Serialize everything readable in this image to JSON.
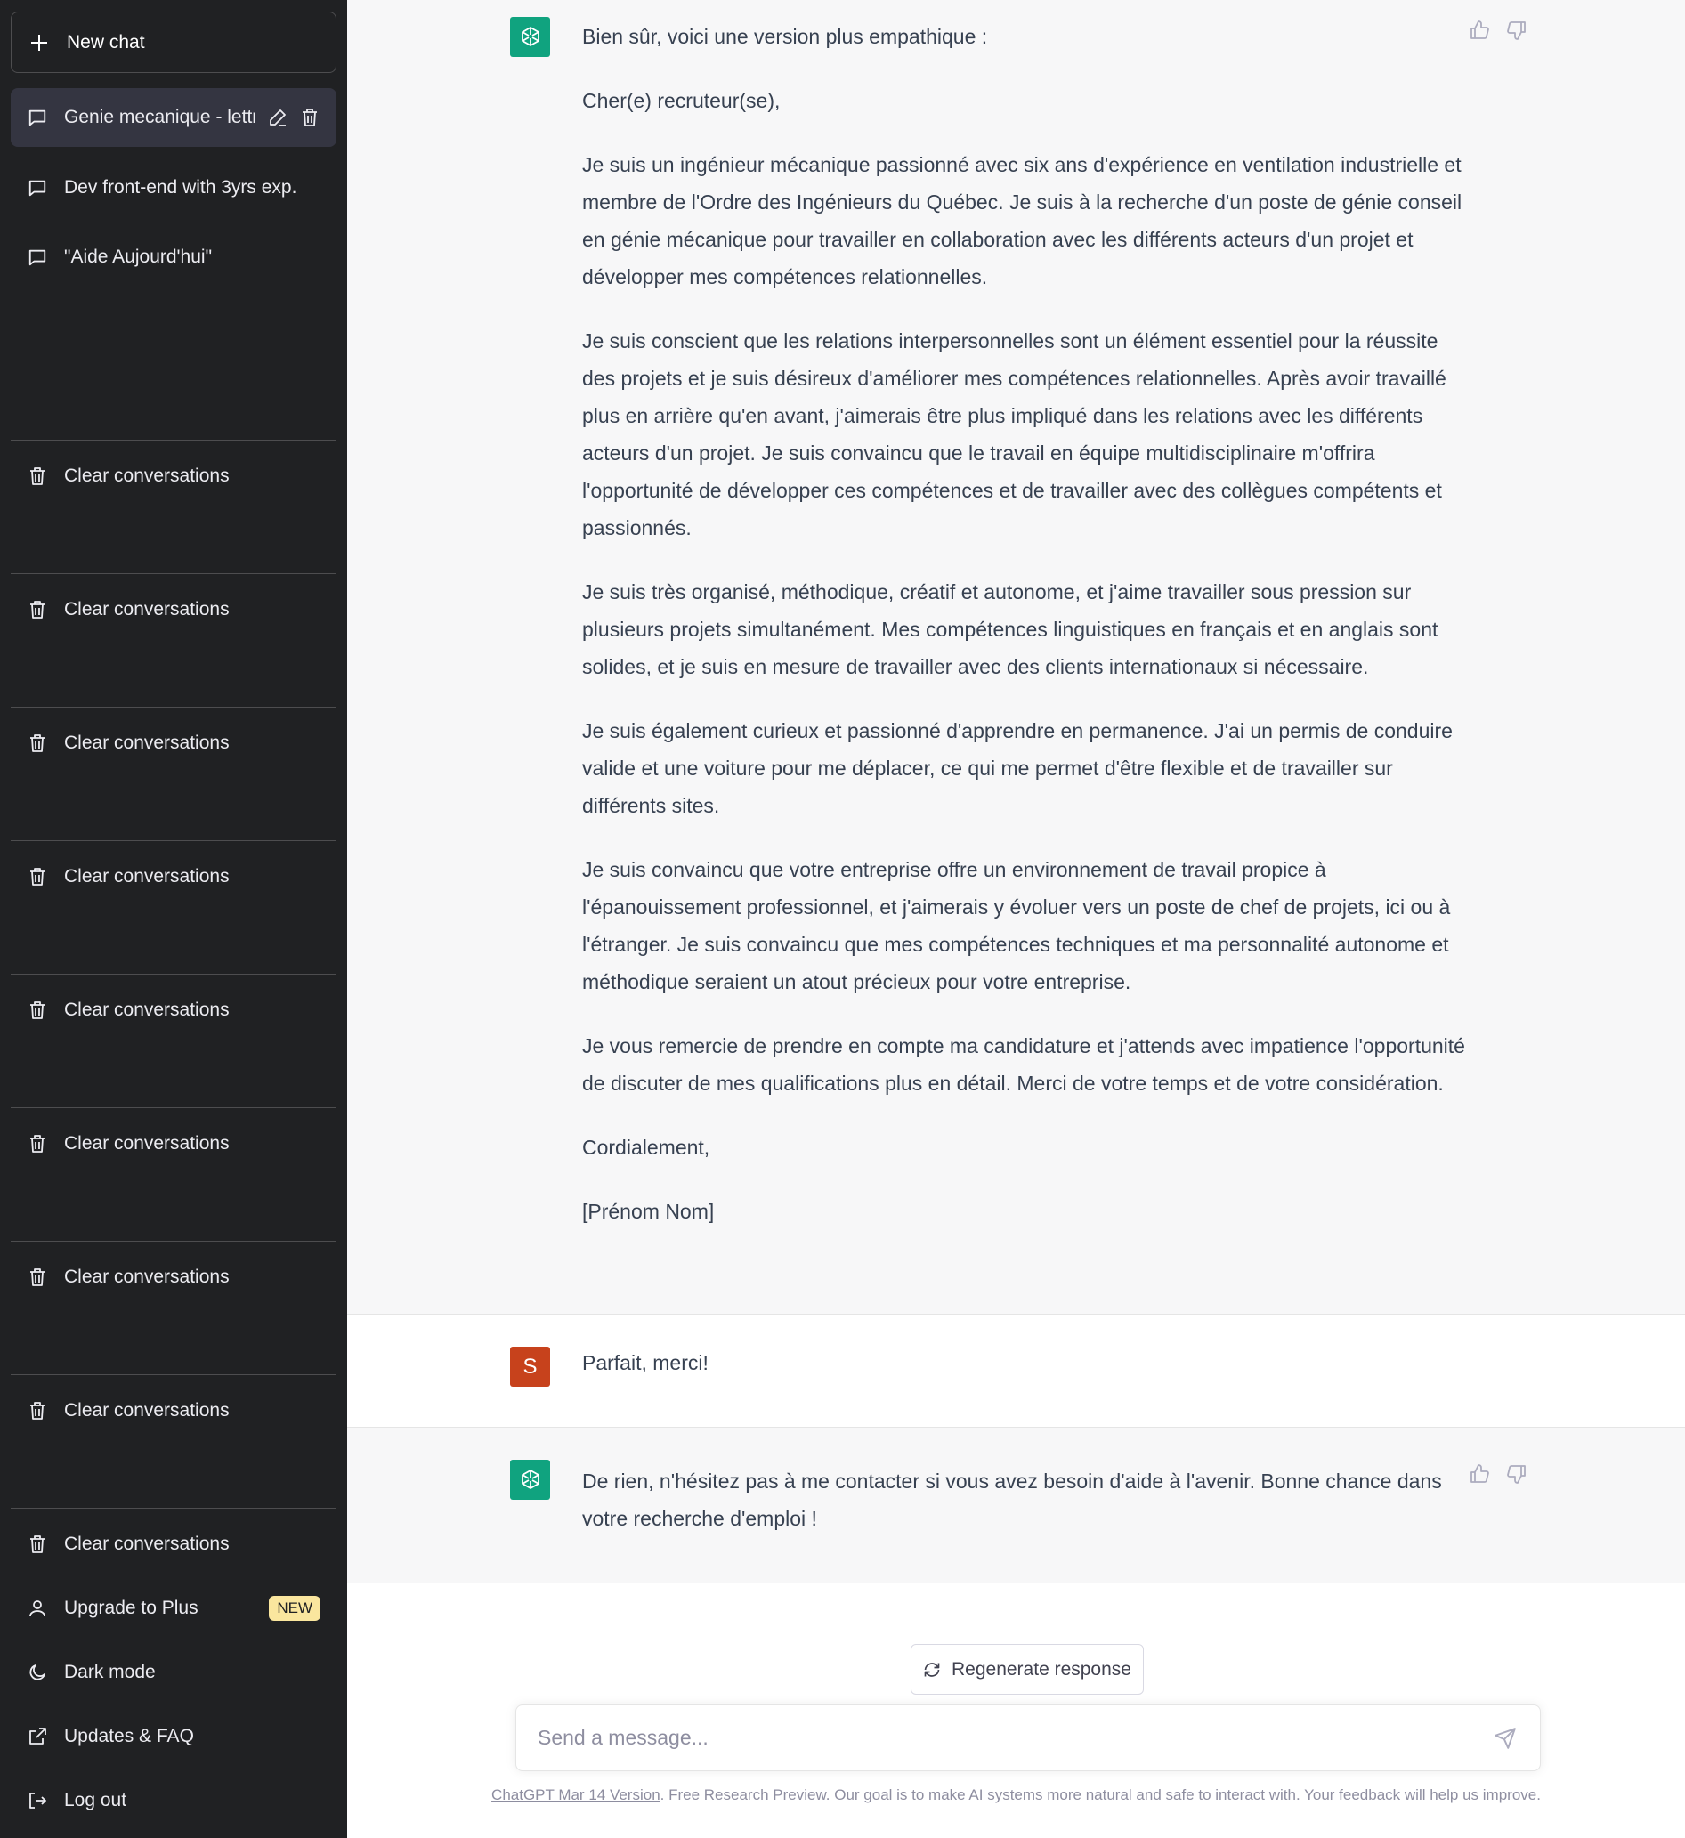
{
  "sidebar": {
    "new_chat": "New chat",
    "conversations": [
      {
        "title": "Genie mecanique - lettr",
        "active": true
      },
      {
        "title": "Dev front-end with 3yrs exp.",
        "active": false
      },
      {
        "title": "\"Aide Aujourd'hui\"",
        "active": false
      }
    ],
    "clear_items": [
      "Clear conversations",
      "Clear conversations",
      "Clear conversations",
      "Clear conversations",
      "Clear conversations",
      "Clear conversations",
      "Clear conversations",
      "Clear conversations",
      "Clear conversations"
    ],
    "menu": {
      "upgrade": "Upgrade to Plus",
      "upgrade_badge": "NEW",
      "dark_mode": "Dark mode",
      "updates": "Updates & FAQ",
      "logout": "Log out"
    }
  },
  "chat": {
    "assistant_1": [
      "Bien sûr, voici une version plus empathique :",
      "Cher(e) recruteur(se),",
      "Je suis un ingénieur mécanique passionné avec six ans d'expérience en ventilation industrielle et membre de l'Ordre des Ingénieurs du Québec. Je suis à la recherche d'un poste de génie conseil en génie mécanique pour travailler en collaboration avec les différents acteurs d'un projet et développer mes compétences relationnelles.",
      "Je suis conscient que les relations interpersonnelles sont un élément essentiel pour la réussite des projets et je suis désireux d'améliorer mes compétences relationnelles. Après avoir travaillé plus en arrière qu'en avant, j'aimerais être plus impliqué dans les relations avec les différents acteurs d'un projet. Je suis convaincu que le travail en équipe multidisciplinaire m'offrira l'opportunité de développer ces compétences et de travailler avec des collègues compétents et passionnés.",
      "Je suis très organisé, méthodique, créatif et autonome, et j'aime travailler sous pression sur plusieurs projets simultanément. Mes compétences linguistiques en français et en anglais sont solides, et je suis en mesure de travailler avec des clients internationaux si nécessaire.",
      "Je suis également curieux et passionné d'apprendre en permanence. J'ai un permis de conduire valide et une voiture pour me déplacer, ce qui me permet d'être flexible et de travailler sur différents sites.",
      "Je suis convaincu que votre entreprise offre un environnement de travail propice à l'épanouissement professionnel, et j'aimerais y évoluer vers un poste de chef de projets, ici ou à l'étranger. Je suis convaincu que mes compétences techniques et ma personnalité autonome et méthodique seraient un atout précieux pour votre entreprise.",
      "Je vous remercie de prendre en compte ma candidature et j'attends avec impatience l'opportunité de discuter de mes qualifications plus en détail. Merci de votre temps et de votre considération.",
      "Cordialement,",
      "[Prénom Nom]"
    ],
    "user_initial": "S",
    "user_message": "Parfait, merci!",
    "assistant_2": "De rien, n'hésitez pas à me contacter si vous avez besoin d'aide à l'avenir. Bonne chance dans votre recherche d'emploi !"
  },
  "composer": {
    "regenerate": "Regenerate response",
    "placeholder": "Send a message..."
  },
  "footer": {
    "link": "ChatGPT Mar 14 Version",
    "text": ". Free Research Preview. Our goal is to make AI systems more natural and safe to interact with. Your feedback will help us improve."
  }
}
